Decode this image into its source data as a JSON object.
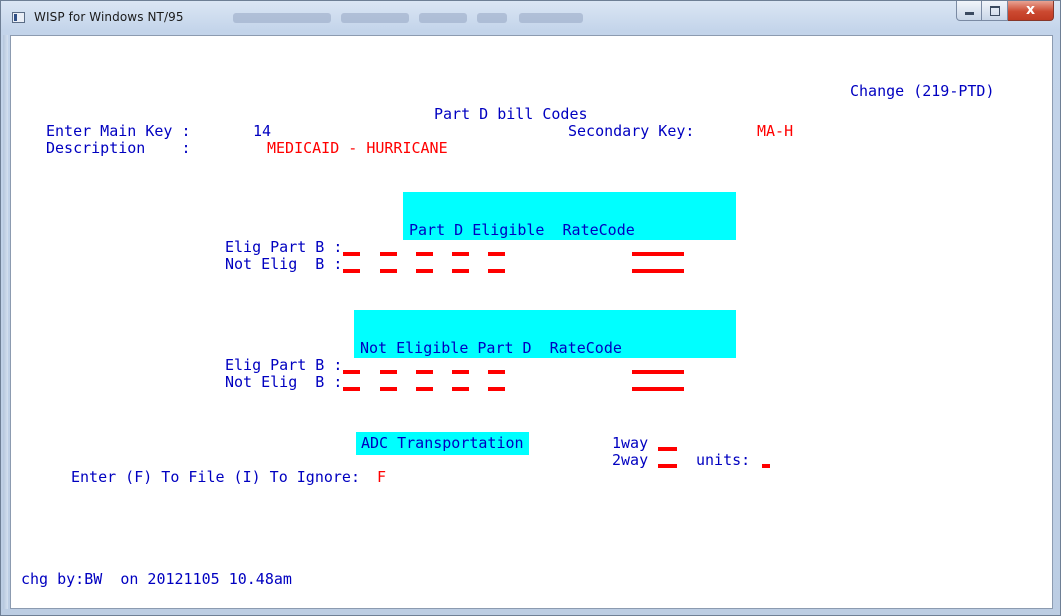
{
  "window": {
    "title": "WISP for Windows NT/95",
    "close_glyph": "x"
  },
  "screen": {
    "mode": "Change (219-PTD)",
    "heading": "Part D bill Codes",
    "main_key_label": "Enter Main Key :",
    "main_key_value": "14",
    "secondary_key_label": "Secondary Key:",
    "secondary_key_value": "MA-H",
    "description_label": "Description    :",
    "description_value": "MEDICAID - HURRICANE",
    "section1_header": "Part D Eligible  RateCode",
    "section2_header": "Not Eligible Part D  RateCode",
    "row_elig_label": "Elig Part B :",
    "row_not_elig_label": "Not Elig  B :",
    "adc_label": "ADC Transportation",
    "oneway_label": "1way",
    "twoway_label": "2way",
    "units_label": "units:",
    "file_prompt": "Enter (F) To File (I) To Ignore:",
    "file_value": "F",
    "footer": "chg by:BW  on 20121105 10.48am"
  }
}
